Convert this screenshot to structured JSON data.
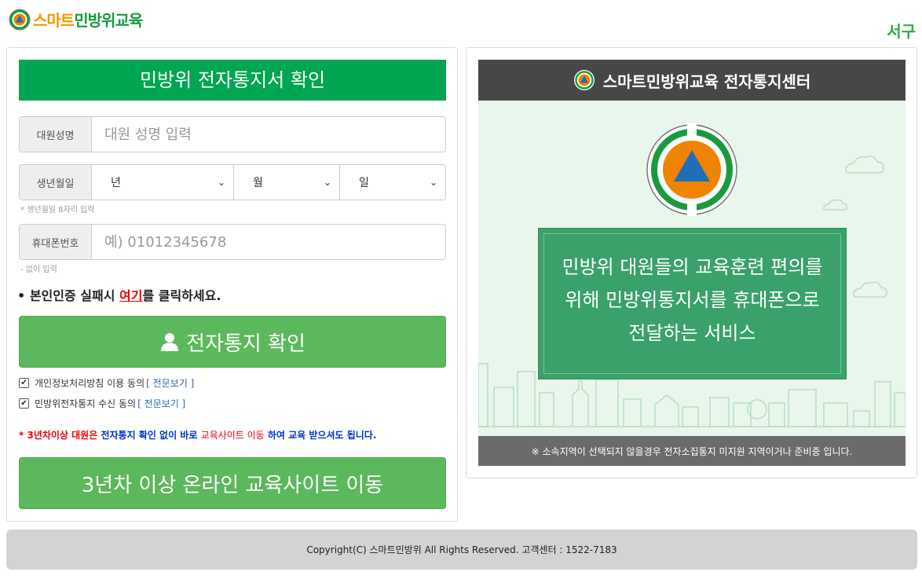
{
  "header": {
    "logo_part1": "스마트",
    "logo_part2": "민방위교육",
    "region": "서구"
  },
  "form": {
    "title": "민방위 전자통지서 확인",
    "name_label": "대원성명",
    "name_placeholder": "대원 성명 입력",
    "birth_label": "생년월일",
    "year_option": "년",
    "month_option": "월",
    "day_option": "일",
    "birth_hint": "* 생년월일 8자리 입력",
    "phone_label": "휴대폰번호",
    "phone_placeholder": "예) 01012345678",
    "phone_hint": "- 없이 입력",
    "notice_prefix": "본인인증 실패시 ",
    "notice_link": "여기",
    "notice_suffix": "를 클릭하세요.",
    "confirm_button": "전자통지 확인",
    "agree_privacy": "개인정보처리방침 이용 동의",
    "agree_notice": "민방위전자통지 수신 동의",
    "view_full": "[ 전문보기 ]",
    "warning_part1": "* 3년차이상 대원은 ",
    "warning_part2": "전자통지 확인 없이 바로 ",
    "warning_part3": "교육사이트 이동",
    "warning_part4": " 하여 교육 받으셔도 됩니다.",
    "online_button": "3년차 이상 온라인 교육사이트 이동"
  },
  "info_panel": {
    "header": "스마트민방위교육 전자통지센터",
    "message_line1": "민방위 대원들의 교육훈련 편의를",
    "message_line2": "위해 민방위통지서를 휴대폰으로",
    "message_line3": "전달하는 서비스",
    "footer_note": "※ 소속지역이 선택되지 않을경우 전자소집통지 미지원 지역이거나 준비중 입니다."
  },
  "footer": {
    "copyright": "Copyright(C) 스마트민방위 All Rights Reserved. 고객센터 : 1522-7183"
  },
  "colors": {
    "brand_green": "#00a651",
    "button_green": "#5cb85c",
    "logo_orange": "#f39800",
    "dark_header": "#474747"
  }
}
